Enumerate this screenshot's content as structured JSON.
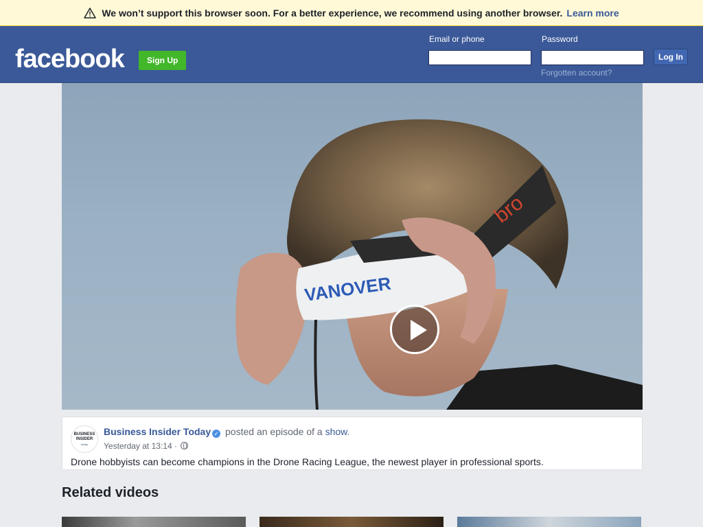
{
  "banner": {
    "message": "We won’t support this browser soon. For a better experience, we recommend using another browser.",
    "link": "Learn more",
    "icon": "warning-icon"
  },
  "header": {
    "logo": "facebook",
    "signup_label": "Sign Up",
    "email_label": "Email or phone",
    "email_value": "",
    "password_label": "Password",
    "password_value": "",
    "forgot_label": "Forgotten account?",
    "login_label": "Log In",
    "colors": {
      "bar": "#3b5998",
      "signup": "#42b72a",
      "login": "#4267b2"
    }
  },
  "video": {
    "goggle_text": "VANOVER",
    "strap_text": "bro",
    "play_icon": "play-icon"
  },
  "post": {
    "avatar_text": [
      "BUSINESS",
      "INSIDER",
      "today"
    ],
    "page_name": "Business Insider Today",
    "action_text": "posted an episode of a",
    "show_link": "show",
    "period": ".",
    "timestamp": "Yesterday at 13:14",
    "separator": "·",
    "description": "Drone hobbyists can become champions in the Drone Racing League, the newest player in professional sports."
  },
  "related": {
    "title": "Related videos"
  }
}
